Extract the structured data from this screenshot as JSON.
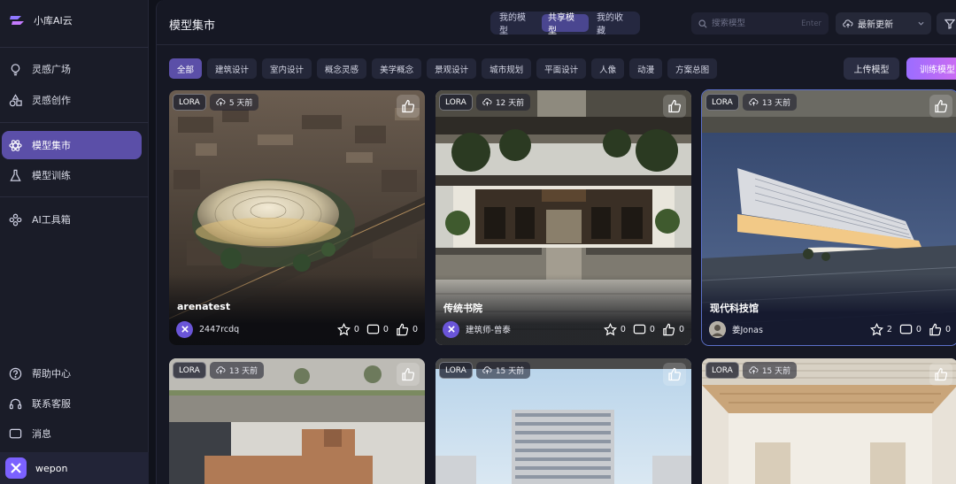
{
  "sidebar": {
    "brand": "小库AI云",
    "nav": [
      {
        "label": "灵感广场",
        "icon": "bulb-icon"
      },
      {
        "label": "灵感创作",
        "icon": "shapes-icon"
      },
      {
        "label": "模型集市",
        "icon": "atom-icon",
        "active": true
      },
      {
        "label": "模型训练",
        "icon": "flask-icon"
      },
      {
        "label": "AI工具箱",
        "icon": "plus-cross-icon"
      }
    ],
    "bottom": [
      {
        "label": "帮助中心",
        "icon": "help-icon"
      },
      {
        "label": "联系客服",
        "icon": "headset-icon"
      },
      {
        "label": "消息",
        "icon": "message-icon"
      }
    ],
    "user": {
      "name": "wepon"
    }
  },
  "header": {
    "title": "模型集市",
    "tabs": [
      "我的模型",
      "共享模型",
      "我的收藏"
    ],
    "active_tab": 1,
    "search": {
      "placeholder": "搜索模型",
      "hint": "Enter"
    },
    "sort": "最新更新"
  },
  "categories": [
    "全部",
    "建筑设计",
    "室内设计",
    "概念灵感",
    "美学概念",
    "景观设计",
    "城市规划",
    "平面设计",
    "人像",
    "动漫",
    "方案总图"
  ],
  "active_category": 0,
  "actions": {
    "upload": "上传模型",
    "train": "训练模型"
  },
  "cards": [
    {
      "tag": "LORA",
      "time": "5 天前",
      "title": "arenatest",
      "author": "2447rcdq",
      "stars": "0",
      "comments": "0",
      "likes": "0"
    },
    {
      "tag": "LORA",
      "time": "12 天前",
      "title": "传统书院",
      "author": "建筑师-曾泰",
      "stars": "0",
      "comments": "0",
      "likes": "0"
    },
    {
      "tag": "LORA",
      "time": "13 天前",
      "title": "现代科技馆",
      "author": "姜Jonas",
      "stars": "2",
      "comments": "0",
      "likes": "0"
    },
    {
      "tag": "LORA",
      "time": "13 天前"
    },
    {
      "tag": "LORA",
      "time": "15 天前"
    },
    {
      "tag": "LORA",
      "time": "15 天前"
    }
  ],
  "colors": {
    "accent": "#5b4fa8",
    "train_gradient": [
      "#9b6dff",
      "#d56bf0"
    ],
    "background": "#10121b"
  }
}
